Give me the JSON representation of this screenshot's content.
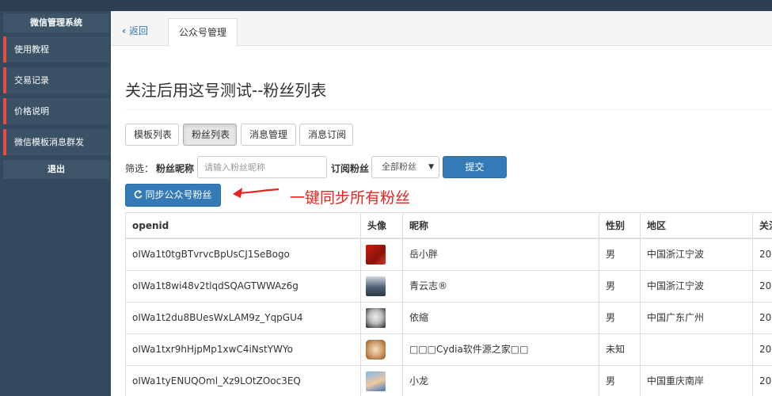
{
  "sidebar": {
    "brand": "微信管理系统",
    "items": [
      {
        "label": "使用教程"
      },
      {
        "label": "交易记录"
      },
      {
        "label": "价格说明"
      },
      {
        "label": "微信模板消息群发"
      }
    ],
    "exit": "退出"
  },
  "tabs": {
    "back_label": "返回",
    "active_label": "公众号管理"
  },
  "page": {
    "title": "关注后用这号测试--粉丝列表"
  },
  "nav_buttons": [
    {
      "label": "模板列表"
    },
    {
      "label": "粉丝列表",
      "active": true
    },
    {
      "label": "消息管理"
    },
    {
      "label": "消息订阅"
    }
  ],
  "filter": {
    "prefix": "筛选：",
    "nickname_label": "粉丝昵称",
    "nickname_placeholder": "请输入粉丝昵称",
    "subscribe_label": "订阅粉丝",
    "subscribe_selected": "全部粉丝",
    "submit_label": "提交"
  },
  "sync": {
    "label": "同步公众号粉丝",
    "annotation": "一键同步所有粉丝"
  },
  "table": {
    "headers": [
      "openid",
      "头像",
      "昵称",
      "性别",
      "地区",
      "关注"
    ],
    "rows": [
      {
        "openid": "oIWa1t0tgBTvrvcBpUsCJ1SeBogo",
        "nickname": "岳小胖",
        "gender": "男",
        "region": "中国浙江宁波",
        "followed": "20"
      },
      {
        "openid": "oIWa1t8wi48v2tlqdSQAGTWWAz6g",
        "nickname": "青云志®",
        "gender": "男",
        "region": "中国浙江宁波",
        "followed": "20"
      },
      {
        "openid": "oIWa1t2du8BUesWxLAM9z_YqpGU4",
        "nickname": "依縮",
        "gender": "男",
        "region": "中国广东广州",
        "followed": "20"
      },
      {
        "openid": "oIWa1txr9hHjpMp1xwC4iNstYWYo",
        "nickname": "□□□Cydia软件源之家□□",
        "gender": "未知",
        "region": "",
        "followed": "20"
      },
      {
        "openid": "oIWa1tyENUQOml_Xz9LOtZOoc3EQ",
        "nickname": "小龙",
        "gender": "男",
        "region": "中国重庆南岸",
        "followed": "20"
      }
    ]
  },
  "colors": {
    "sidebar_bg": "#34495e",
    "accent_red": "#e74c3c",
    "primary_blue": "#337ab7",
    "annotation_red": "#e8231f"
  }
}
